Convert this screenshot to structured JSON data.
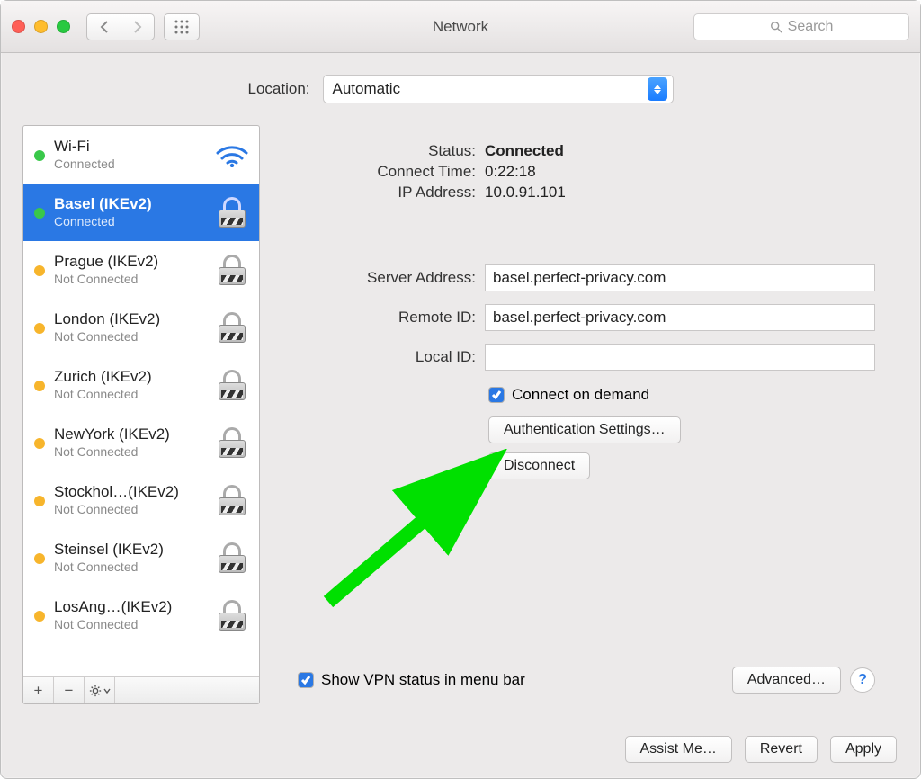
{
  "window": {
    "title": "Network"
  },
  "toolbar": {
    "search_placeholder": "Search"
  },
  "location": {
    "label": "Location:",
    "value": "Automatic"
  },
  "services": [
    {
      "name": "Wi-Fi",
      "subtitle": "Connected",
      "status": "green",
      "icon": "wifi",
      "selected": false
    },
    {
      "name": "Basel (IKEv2)",
      "subtitle": "Connected",
      "status": "green",
      "icon": "lock",
      "selected": true
    },
    {
      "name": "Prague (IKEv2)",
      "subtitle": "Not Connected",
      "status": "orange",
      "icon": "lock",
      "selected": false
    },
    {
      "name": "London (IKEv2)",
      "subtitle": "Not Connected",
      "status": "orange",
      "icon": "lock",
      "selected": false
    },
    {
      "name": "Zurich (IKEv2)",
      "subtitle": "Not Connected",
      "status": "orange",
      "icon": "lock",
      "selected": false
    },
    {
      "name": "NewYork (IKEv2)",
      "subtitle": "Not Connected",
      "status": "orange",
      "icon": "lock",
      "selected": false
    },
    {
      "name": "Stockhol…(IKEv2)",
      "subtitle": "Not Connected",
      "status": "orange",
      "icon": "lock",
      "selected": false
    },
    {
      "name": "Steinsel (IKEv2)",
      "subtitle": "Not Connected",
      "status": "orange",
      "icon": "lock",
      "selected": false
    },
    {
      "name": "LosAng…(IKEv2)",
      "subtitle": "Not Connected",
      "status": "orange",
      "icon": "lock",
      "selected": false
    }
  ],
  "status_block": {
    "status_label": "Status:",
    "status_value": "Connected",
    "connect_time_label": "Connect Time:",
    "connect_time_value": "0:22:18",
    "ip_label": "IP Address:",
    "ip_value": "10.0.91.101"
  },
  "fields": {
    "server_label": "Server Address:",
    "server_value": "basel.perfect-privacy.com",
    "remote_label": "Remote ID:",
    "remote_value": "basel.perfect-privacy.com",
    "local_label": "Local ID:",
    "local_value": ""
  },
  "options": {
    "connect_on_demand": "Connect on demand",
    "auth_settings": "Authentication Settings…",
    "disconnect": "Disconnect",
    "show_vpn": "Show VPN status in menu bar",
    "advanced": "Advanced…"
  },
  "footer": {
    "assist": "Assist Me…",
    "revert": "Revert",
    "apply": "Apply"
  },
  "colors": {
    "accent_blue": "#2a78e4",
    "status_green": "#39c84a",
    "status_orange": "#f7b52c",
    "annotation_green": "#00e000"
  }
}
